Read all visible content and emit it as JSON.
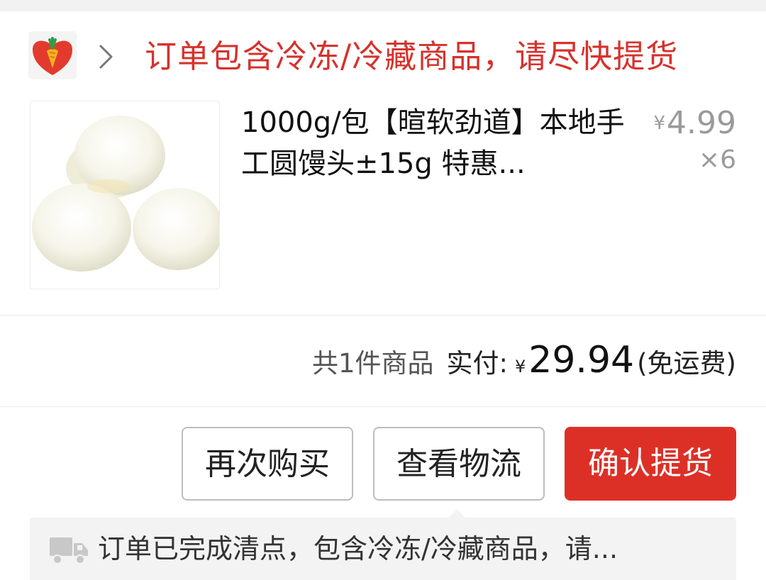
{
  "store": {
    "logo_icon": "carrot-logo-icon",
    "chevron_icon": "chevron-right-icon",
    "notice": "订单包含冷冻/冷藏商品，请尽快提货"
  },
  "product": {
    "image_icon": "steamed-buns-image",
    "name": "1000g/包【暄软劲道】本地手工圆馒头±15g 特惠...",
    "price_symbol": "¥",
    "price": "4.99",
    "quantity": "×6"
  },
  "summary": {
    "item_count": "共1件商品",
    "paid_label": "实付:",
    "currency": "¥",
    "paid_amount": "29.94",
    "shipping_note": "(免运费)"
  },
  "actions": {
    "buy_again": "再次购买",
    "view_logistics": "查看物流",
    "confirm_pickup": "确认提货"
  },
  "delivery": {
    "truck_icon": "truck-icon",
    "message": "订单已完成清点，包含冷冻/冷藏商品，请..."
  },
  "colors": {
    "accent": "#dc3027",
    "notice_text": "#d6322c",
    "muted": "#9a9a9a"
  }
}
